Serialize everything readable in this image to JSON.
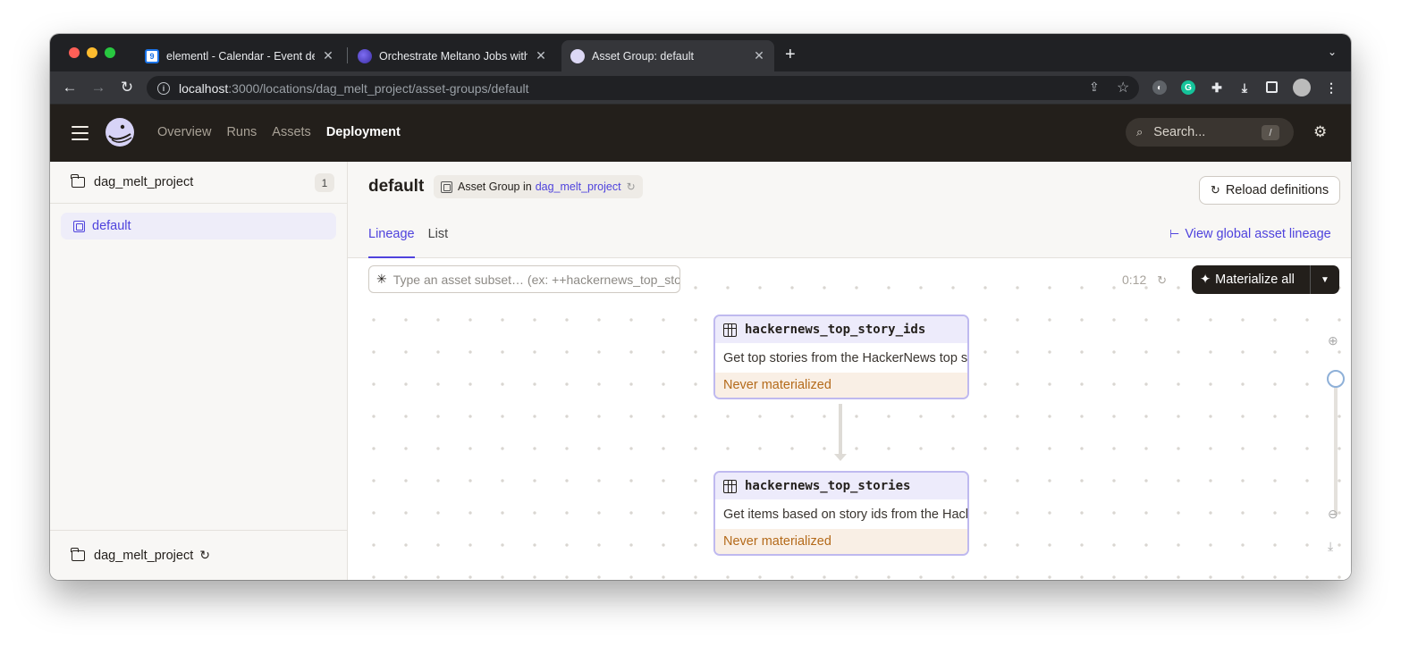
{
  "browser": {
    "tabs": [
      {
        "title": "elementl - Calendar - Event details",
        "favicon": "calendar-icon",
        "active": false
      },
      {
        "title": "Orchestrate Meltano Jobs with Dagster",
        "favicon": "meltano-icon",
        "active": false
      },
      {
        "title": "Asset Group: default",
        "favicon": "dagster-icon",
        "active": true
      }
    ],
    "calendar_favicon_text": "9",
    "url_host": "localhost",
    "url_path": ":3000/locations/dag_melt_project/asset-groups/default"
  },
  "app": {
    "nav": [
      "Overview",
      "Runs",
      "Assets",
      "Deployment"
    ],
    "active_nav": "Deployment",
    "search_placeholder": "Search...",
    "search_shortcut": "/"
  },
  "sidebar": {
    "repo_name": "dag_melt_project",
    "repo_count": "1",
    "items": [
      {
        "label": "default",
        "selected": true
      }
    ],
    "footer_location": "dag_melt_project"
  },
  "page": {
    "title": "default",
    "tag_prefix": "Asset Group in",
    "tag_link": "dag_melt_project",
    "reload_label": "Reload definitions",
    "tabs": [
      "Lineage",
      "List"
    ],
    "active_tab": "Lineage",
    "view_global_label": "View global asset lineage",
    "subset_placeholder": "Type an asset subset… (ex: ++hackernews_top_story_ids)",
    "refresh_timer": "0:12",
    "materialize_label": "Materialize all"
  },
  "graph": {
    "nodes": [
      {
        "name": "hackernews_top_story_ids",
        "description": "Get top stories from the HackerNews top stories endpoint.",
        "status": "Never materialized"
      },
      {
        "name": "hackernews_top_stories",
        "description": "Get items based on story ids from the HackerNews items endpoint.",
        "status": "Never materialized"
      }
    ]
  },
  "colors": {
    "accent": "#4f43dd",
    "header_bg": "#231f1b",
    "status_warning": "#b46a1a"
  }
}
